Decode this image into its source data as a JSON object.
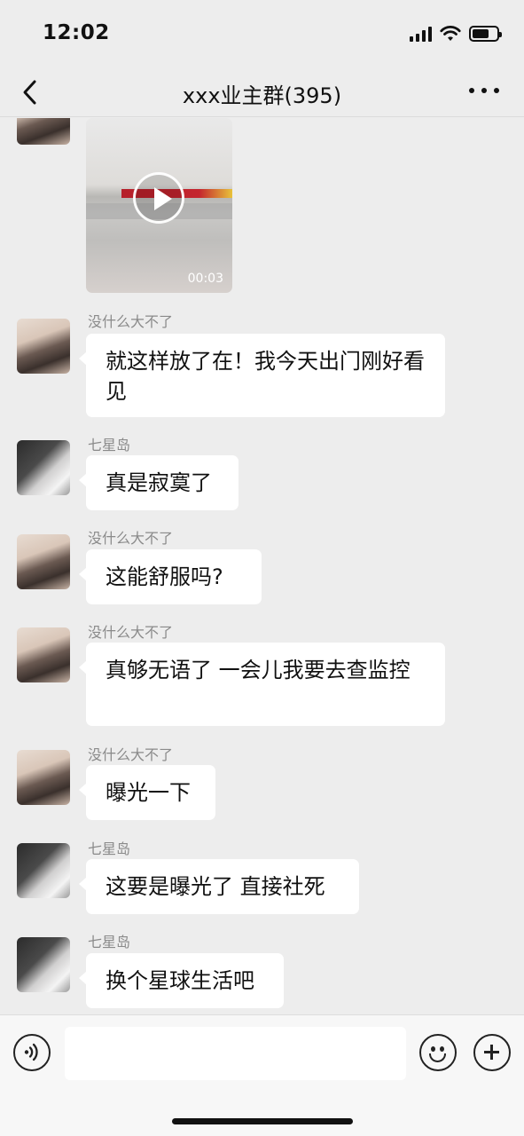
{
  "status_bar": {
    "time": "12:02"
  },
  "nav": {
    "title": "xxx业主群(395)"
  },
  "video_message": {
    "duration": "00:03",
    "sender_avatar": "avatar-a"
  },
  "messages": [
    {
      "sender": "没什么大不了",
      "text": "就这样放了在！我今天出门刚好看见",
      "avatar": "avatar-a"
    },
    {
      "sender": "七星岛",
      "text": "真是寂寞了",
      "avatar": "avatar-b"
    },
    {
      "sender": "没什么大不了",
      "text": "这能舒服吗?",
      "avatar": "avatar-a"
    },
    {
      "sender": "没什么大不了",
      "text": "真够无语了 一会儿我要去查监控",
      "avatar": "avatar-a"
    },
    {
      "sender": "没什么大不了",
      "text": "曝光一下",
      "avatar": "avatar-a"
    },
    {
      "sender": "七星岛",
      "text": "这要是曝光了 直接社死",
      "avatar": "avatar-b"
    },
    {
      "sender": "七星岛",
      "text": "换个星球生活吧",
      "avatar": "avatar-b"
    }
  ],
  "input": {
    "value": "",
    "placeholder": ""
  },
  "icons": {
    "back": "chevron-left-icon",
    "more": "more-dots-icon",
    "voice": "voice-icon",
    "emoji": "emoji-icon",
    "plus": "plus-icon",
    "play": "play-icon"
  }
}
